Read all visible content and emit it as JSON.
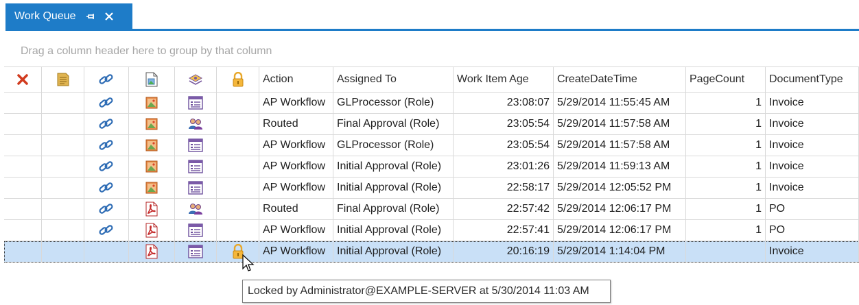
{
  "tab": {
    "title": "Work Queue"
  },
  "group_panel": {
    "hint": "Drag a column header here to group by that column"
  },
  "header": {
    "icon_columns": [
      "delete-icon",
      "notes-icon",
      "link-icon",
      "document-preview-icon",
      "workflow-type-icon",
      "lock-icon"
    ],
    "columns": [
      "Action",
      "Assigned To",
      "Work Item Age",
      "CreateDateTime",
      "PageCount",
      "DocumentType"
    ]
  },
  "rows": [
    {
      "link": true,
      "doc_icon": "image-document-icon",
      "type_icon": "form-icon",
      "locked": false,
      "action": "AP Workflow",
      "assigned_to": "GLProcessor (Role)",
      "age": "23:08:07",
      "created": "5/29/2014 11:55:45 AM",
      "page_count": "1",
      "document_type": "Invoice"
    },
    {
      "link": true,
      "doc_icon": "image-document-icon",
      "type_icon": "users-icon",
      "locked": false,
      "action": "Routed",
      "assigned_to": "Final Approval (Role)",
      "age": "23:05:54",
      "created": "5/29/2014 11:57:58 AM",
      "page_count": "1",
      "document_type": "Invoice"
    },
    {
      "link": true,
      "doc_icon": "image-document-icon",
      "type_icon": "form-icon",
      "locked": false,
      "action": "AP Workflow",
      "assigned_to": "GLProcessor (Role)",
      "age": "23:05:54",
      "created": "5/29/2014 11:57:58 AM",
      "page_count": "1",
      "document_type": "Invoice"
    },
    {
      "link": true,
      "doc_icon": "image-document-icon",
      "type_icon": "form-icon",
      "locked": false,
      "action": "AP Workflow",
      "assigned_to": "Initial Approval (Role)",
      "age": "23:01:26",
      "created": "5/29/2014 11:59:13 AM",
      "page_count": "1",
      "document_type": "Invoice"
    },
    {
      "link": true,
      "doc_icon": "image-document-icon",
      "type_icon": "form-icon",
      "locked": false,
      "action": "AP Workflow",
      "assigned_to": "Initial Approval (Role)",
      "age": "22:58:17",
      "created": "5/29/2014 12:05:52 PM",
      "page_count": "1",
      "document_type": "Invoice"
    },
    {
      "link": true,
      "doc_icon": "pdf-icon",
      "type_icon": "users-icon",
      "locked": false,
      "action": "Routed",
      "assigned_to": "Final Approval (Role)",
      "age": "22:57:42",
      "created": "5/29/2014 12:06:17 PM",
      "page_count": "1",
      "document_type": "PO"
    },
    {
      "link": true,
      "doc_icon": "pdf-icon",
      "type_icon": "form-icon",
      "locked": false,
      "action": "AP Workflow",
      "assigned_to": "Initial Approval (Role)",
      "age": "22:57:41",
      "created": "5/29/2014 12:06:17 PM",
      "page_count": "1",
      "document_type": "PO"
    },
    {
      "link": false,
      "doc_icon": "pdf-icon",
      "type_icon": "form-icon",
      "locked": true,
      "selected": true,
      "action": "AP Workflow",
      "assigned_to": "Initial Approval (Role)",
      "age": "20:16:19",
      "created": "5/29/2014 1:14:04 PM",
      "page_count": "",
      "document_type": "Invoice"
    }
  ],
  "tooltip": {
    "text": "Locked by Administrator@EXAMPLE-SERVER at 5/30/2014 11:03 AM"
  },
  "colors": {
    "accent": "#1e7cc8",
    "selected_row": "#c9e0f7",
    "delete": "#d13b1f",
    "link": "#2f6db5"
  }
}
